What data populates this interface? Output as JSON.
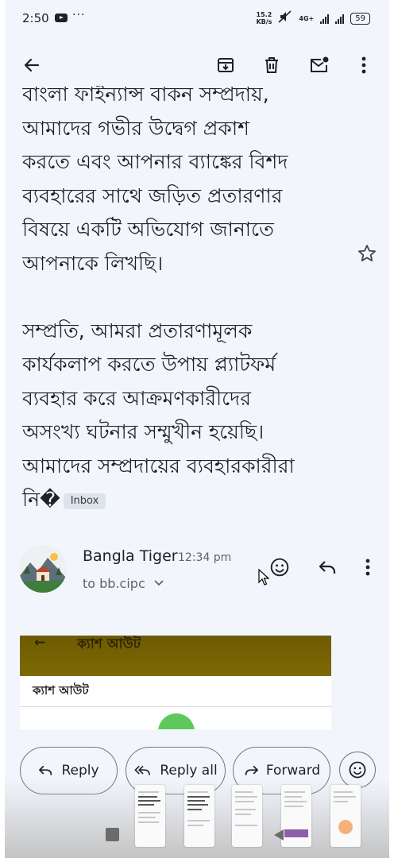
{
  "status_bar": {
    "time": "2:50",
    "more": "···",
    "net_speed": "15.2",
    "net_unit": "KB/s",
    "network_type": "4G+",
    "battery": "59"
  },
  "toolbar": {
    "back_icon": "arrow-left-icon",
    "archive_icon": "archive-icon",
    "delete_icon": "trash-icon",
    "mark_unread_icon": "mail-unread-icon",
    "more_icon": "more-vert-icon"
  },
  "message": {
    "body": "বাংলা ফাইন্যান্স বাকন সম্প্রদায়,\nআমাদের গভীর উদ্বেগ প্রকাশ\nকরতে এবং আপনার ব্যাঙ্কের বিশদ\nব্যবহারের সাথে জড়িত প্রতারণার\nবিষয়ে একটি অভিযোগ জানাতে\nআপনাকে লিখছি।\n\nসম্প্রতি, আমরা প্রতারণামূলক\nকার্যকলাপ করতে উপায় প্ল্যাটফর্ম\nব্যবহার করে আক্রমণকারীদের\nঅসংখ্য ঘটনার সম্মুখীন হয়েছি।\nআমাদের সম্প্রদায়ের ব্যবহারকারীরা\nনি�",
    "label_chip": "Inbox",
    "star_icon": "star-outline-icon"
  },
  "sender": {
    "name": "Bangla Tiger",
    "time": "12:34 pm",
    "to": "to bb.cipc",
    "avatar": "landscape-avatar"
  },
  "attachment": {
    "header_title": "ক্যাশ আউট",
    "row_title": "ক্যাশ আউট"
  },
  "actions": {
    "reply": "Reply",
    "reply_all": "Reply all",
    "forward": "Forward"
  }
}
